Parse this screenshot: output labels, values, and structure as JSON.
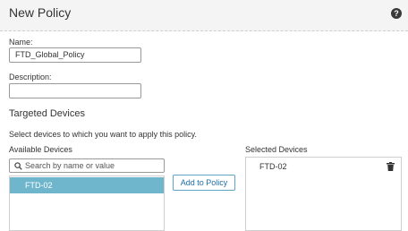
{
  "header": {
    "title": "New Policy",
    "help_glyph": "?"
  },
  "form": {
    "name_label": "Name:",
    "name_value": "FTD_Global_Policy",
    "description_label": "Description:",
    "description_value": ""
  },
  "targeted": {
    "title": "Targeted Devices",
    "instruction": "Select devices to which you want to apply this policy."
  },
  "available": {
    "label": "Available Devices",
    "search_placeholder": "Search by name or value",
    "items": [
      "FTD-02"
    ]
  },
  "add_button_label": "Add to Policy",
  "selected": {
    "label": "Selected Devices",
    "items": [
      "FTD-02"
    ]
  },
  "icons": {
    "help": "help-icon",
    "search": "search-icon",
    "delete": "trash-icon"
  },
  "colors": {
    "selected_row": "#6fb6cc",
    "button_border": "#5da4c7",
    "button_text": "#1e6fa8"
  }
}
